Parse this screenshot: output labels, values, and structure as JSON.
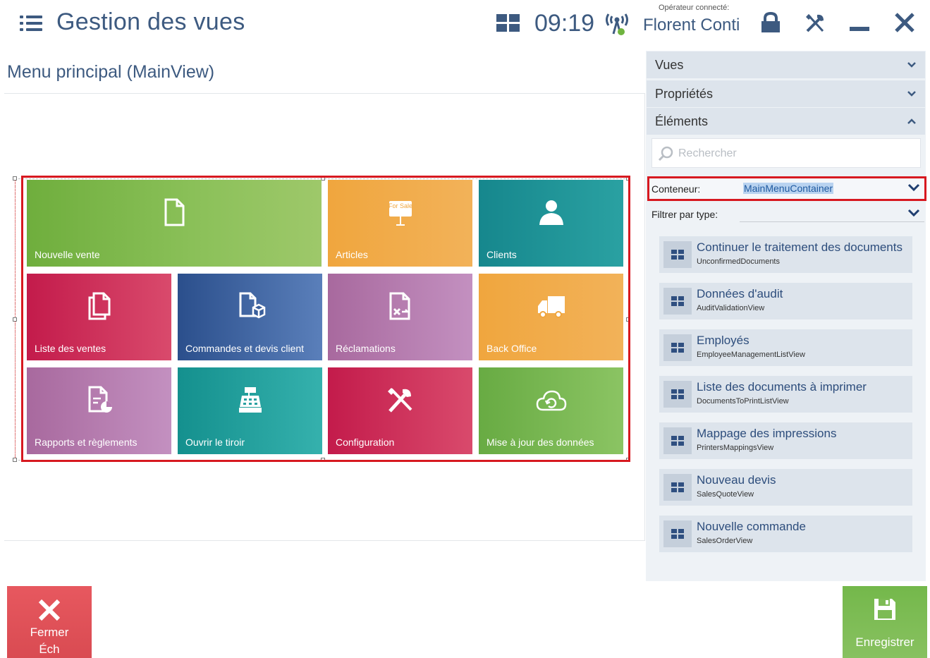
{
  "header": {
    "title": "Gestion des vues",
    "clock": "09:19",
    "operator_label": "Opérateur connecté:",
    "operator_name": "Florent Conti"
  },
  "canvas": {
    "view_title": "Menu principal (MainView)",
    "tiles": [
      {
        "label": "Nouvelle vente",
        "icon": "new-document-icon"
      },
      {
        "label": "Articles",
        "icon": "for-sale-sign-icon",
        "sign_text": "For Sale"
      },
      {
        "label": "Clients",
        "icon": "person-icon"
      },
      {
        "label": "Liste des ventes",
        "icon": "documents-icon"
      },
      {
        "label": "Commandes et devis client",
        "icon": "document-package-icon"
      },
      {
        "label": "Réclamations",
        "icon": "document-return-icon"
      },
      {
        "label": "Back Office",
        "icon": "delivery-truck-icon"
      },
      {
        "label": "Rapports et règlements",
        "icon": "report-chart-icon"
      },
      {
        "label": "Ouvrir le tiroir",
        "icon": "cash-register-icon"
      },
      {
        "label": "Configuration",
        "icon": "tools-icon"
      },
      {
        "label": "Mise à jour des données",
        "icon": "cloud-sync-icon"
      }
    ]
  },
  "panel": {
    "sections": {
      "views": "Vues",
      "properties": "Propriétés",
      "elements": "Éléments"
    },
    "search_placeholder": "Rechercher",
    "container_label": "Conteneur:",
    "container_value": "MainMenuContainer",
    "filter_label": "Filtrer par type:",
    "items": [
      {
        "title": "Continuer le traitement des documents",
        "subtitle": "UnconfirmedDocuments"
      },
      {
        "title": "Données d'audit",
        "subtitle": "AuditValidationView"
      },
      {
        "title": "Employés",
        "subtitle": "EmployeeManagementListView"
      },
      {
        "title": "Liste des documents à imprimer",
        "subtitle": "DocumentsToPrintListView"
      },
      {
        "title": "Mappage des impressions",
        "subtitle": "PrintersMappingsView"
      },
      {
        "title": "Nouveau devis",
        "subtitle": "SalesQuoteView"
      },
      {
        "title": "Nouvelle commande",
        "subtitle": "SalesOrderView"
      }
    ]
  },
  "footer": {
    "close_label_1": "Fermer",
    "close_label_2": "Éch",
    "save_label": "Enregistrer"
  },
  "colors": {
    "accent": "#3d5a80",
    "selection": "#d71920",
    "close_button": "#e05259",
    "save_button": "#7dbb55"
  }
}
